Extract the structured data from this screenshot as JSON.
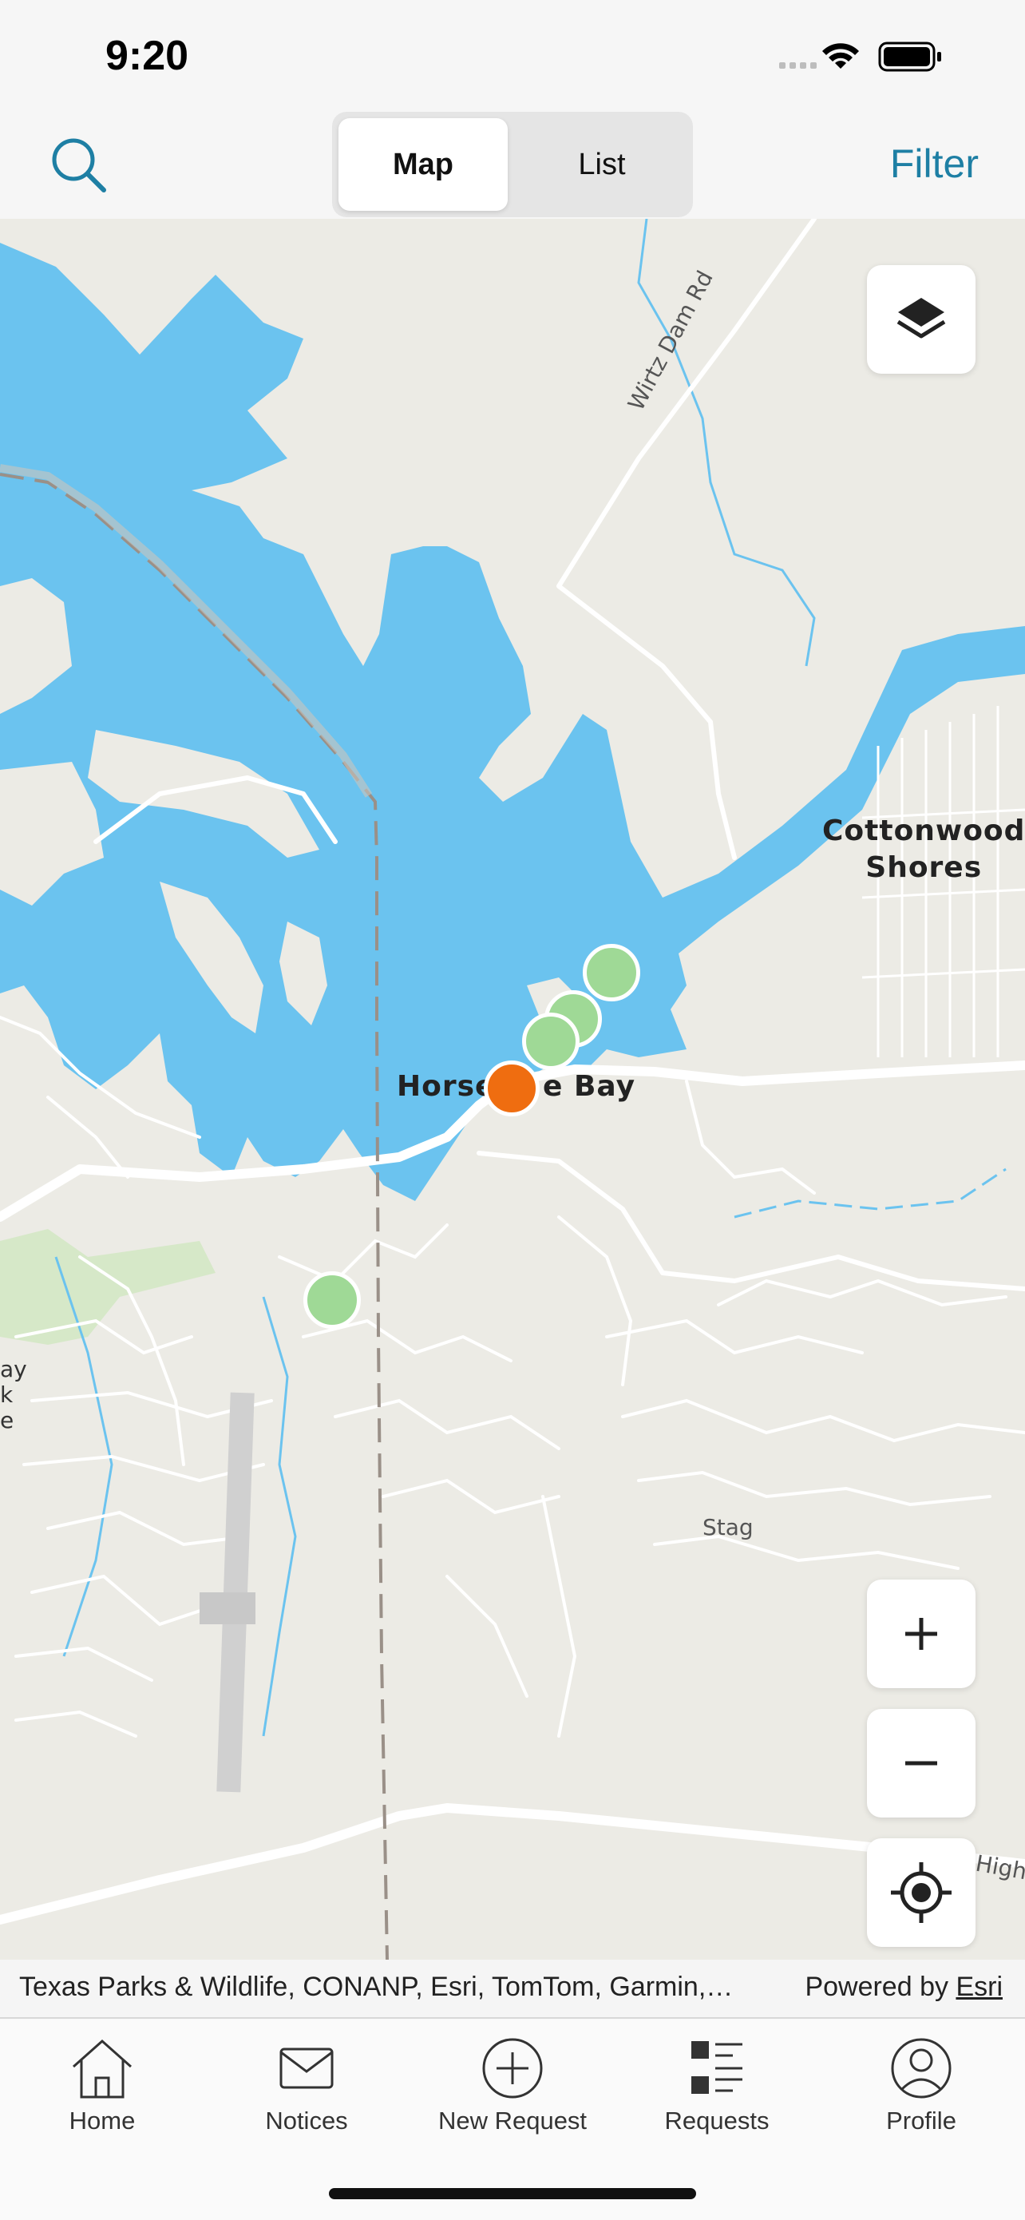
{
  "status_bar": {
    "time": "9:20"
  },
  "nav": {
    "tabs": [
      {
        "label": "Map",
        "active": true
      },
      {
        "label": "List",
        "active": false
      }
    ],
    "filter_label": "Filter"
  },
  "map": {
    "place_labels": {
      "cottonwood_shores": "Cottonwood\nShores",
      "horseshoe_bay_left": "Horse",
      "horseshoe_bay_right": "e Bay"
    },
    "road_labels": {
      "wirtz_dam": "Wirtz Dam Rd",
      "stag": "Stag",
      "high": "High"
    },
    "edge_labels": [
      "ay",
      "k",
      "e"
    ],
    "markers": [
      {
        "status": "open",
        "color": "#9fd996"
      },
      {
        "status": "open",
        "color": "#9fd996"
      },
      {
        "status": "open",
        "color": "#9fd996"
      },
      {
        "status": "open",
        "color": "#9fd996"
      },
      {
        "status": "selected",
        "color": "#ef6d10"
      }
    ],
    "controls": [
      "layers-icon",
      "zoom-in-icon",
      "zoom-out-icon",
      "locate-icon"
    ],
    "colors": {
      "water": "#6bc3ef",
      "land": "#ecebe5",
      "road": "#ffffff",
      "park": "#d6e8c8"
    }
  },
  "attribution": {
    "sources": "Texas Parks & Wildlife, CONANP, Esri, TomTom, Garmin,…",
    "powered_by": "Powered by",
    "powered_by_link": "Esri"
  },
  "tab_bar": {
    "items": [
      {
        "label": "Home",
        "icon": "home-icon"
      },
      {
        "label": "Notices",
        "icon": "envelope-icon"
      },
      {
        "label": "New Request",
        "icon": "plus-circle-icon"
      },
      {
        "label": "Requests",
        "icon": "list-icon"
      },
      {
        "label": "Profile",
        "icon": "person-icon"
      }
    ]
  }
}
